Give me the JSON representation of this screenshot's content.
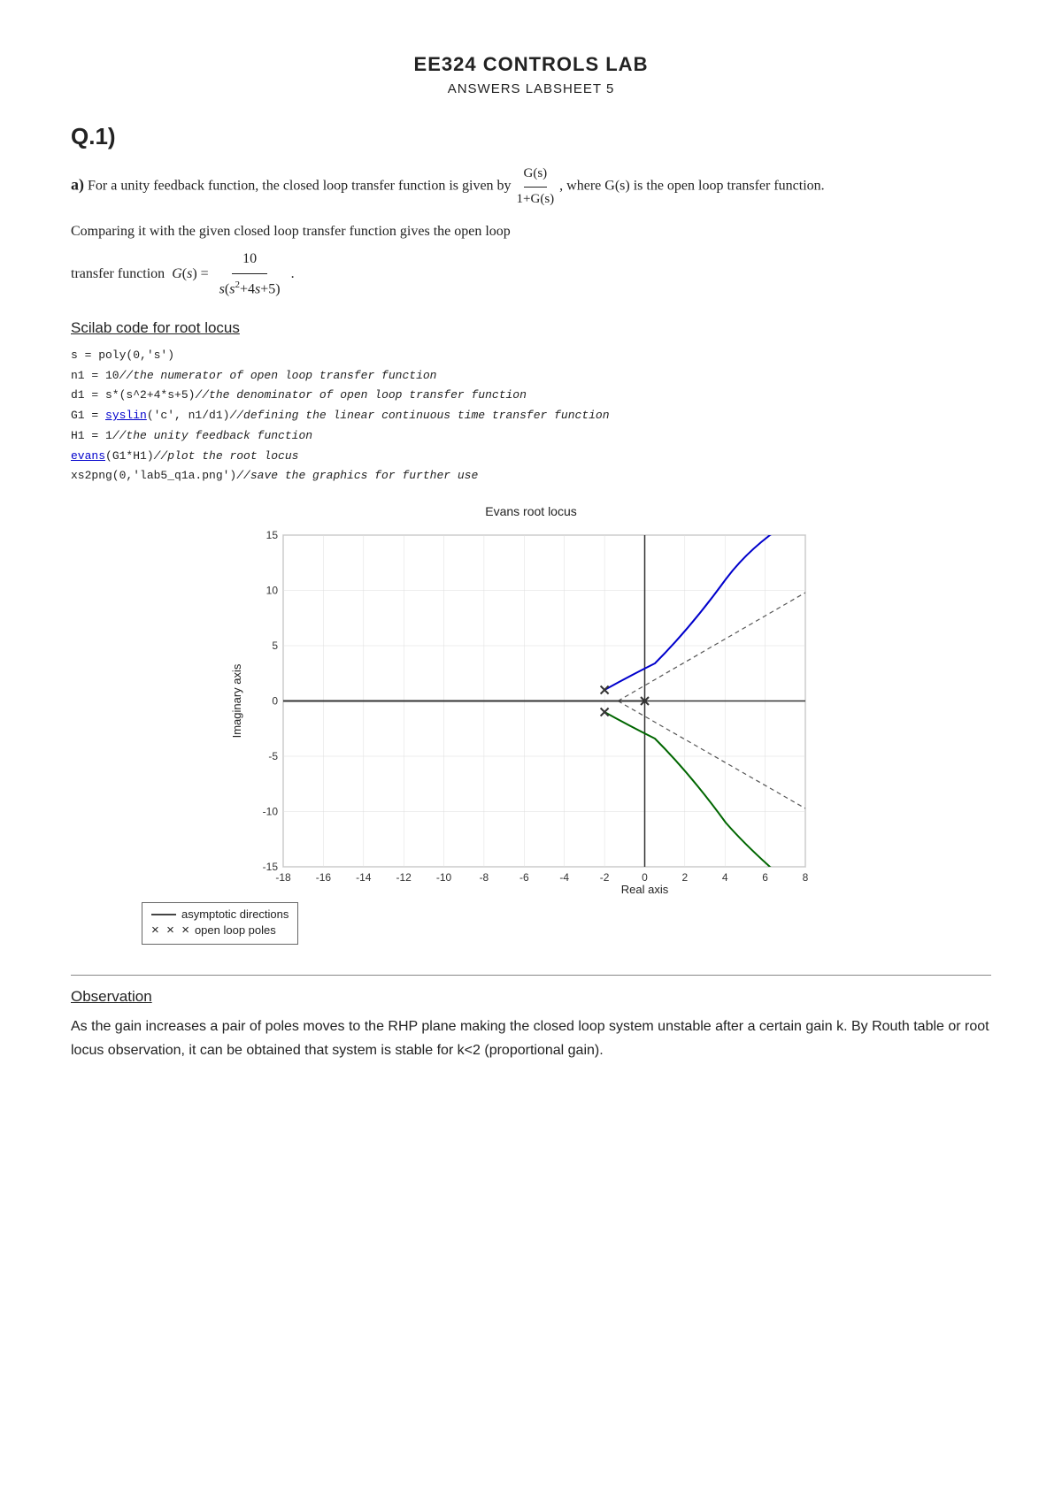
{
  "header": {
    "title": "EE324 CONTROLS LAB",
    "subtitle": "ANSWERS LABSHEET 5"
  },
  "question": {
    "label": "Q.1)",
    "part_a_intro": "For a unity feedback function, the closed loop transfer function is given by",
    "fraction_num": "G(s)",
    "fraction_den": "1+G(s)",
    "after_fraction": ", where G(s) is the open loop transfer function.",
    "comparing_line1": "Comparing it with the given closed loop transfer function gives the open loop",
    "comparing_line2_prefix": "transfer function",
    "open_loop_tf": "G(s) = 10 / s(s²+4s+5)",
    "scilab_heading": "Scilab code for root locus",
    "code_lines": [
      {
        "text": "s = poly(0,'s')"
      },
      {
        "text": "n1 = 10",
        "comment": "//the numerator of open loop transfer function"
      },
      {
        "text": "d1 = s*(s^2+4*s+5)",
        "comment": "//the denominator of open loop transfer function"
      },
      {
        "text": "G1 = syslin('c', n1/d1)",
        "comment": "//defining the linear continuous time transfer function",
        "link": "syslin"
      },
      {
        "text": "H1 = 1",
        "comment": "//the unity feedback function"
      },
      {
        "text": "evans(G1*H1)",
        "comment": "//plot the root locus",
        "link": "evans"
      },
      {
        "text": "xs2png(0,'lab5_q1a.png')",
        "comment": "//save the graphics for further use"
      }
    ],
    "plot_title": "Evans root locus",
    "plot_xlabel": "Real axis",
    "plot_ylabel": "Imaginary axis",
    "x_axis_labels": [
      "-18",
      "-16",
      "-14",
      "-12",
      "-10",
      "-8",
      "-6",
      "-4",
      "-2",
      "0",
      "2",
      "4",
      "6",
      "8"
    ],
    "y_axis_labels": [
      "15",
      "10",
      "5",
      "0",
      "-5",
      "-10",
      "-15"
    ],
    "legend": {
      "line_label": "asymptotic directions",
      "x_label": "open loop poles"
    },
    "observation_heading": "Observation",
    "observation_text": "As the gain increases a pair of poles moves to the RHP plane making the closed loop system unstable after a certain gain k. By Routh table or root locus observation, it can be obtained that system is stable for k<2 (proportional gain)."
  }
}
